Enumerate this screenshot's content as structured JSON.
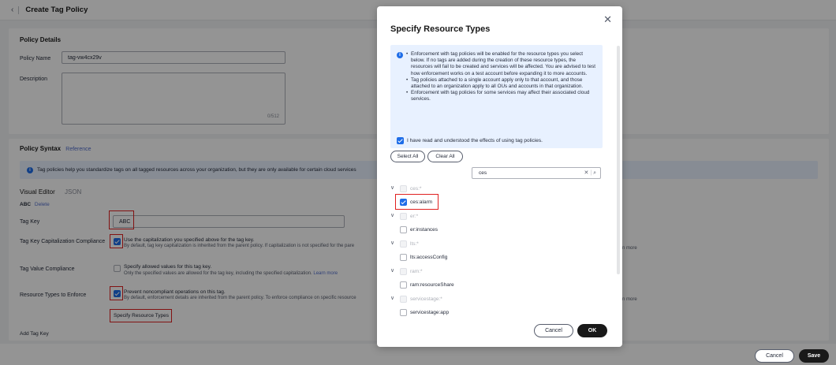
{
  "header": {
    "back_icon": "chevron-left-icon",
    "title": "Create Tag Policy"
  },
  "policy_details": {
    "section_title": "Policy Details",
    "name_label": "Policy Name",
    "name_value": "tag-vw4cx29v",
    "description_label": "Description",
    "description_counter": "0/512"
  },
  "policy_syntax": {
    "section_title": "Policy Syntax",
    "reference_link": "Reference",
    "info_text": "Tag policies help you standardize tags on all tagged resources across your organization, but they are only available for certain cloud services",
    "tab_visual": "Visual Editor",
    "tab_json": "JSON",
    "tag_name": "ABC",
    "delete_link": "Delete",
    "tag_key_label": "Tag Key",
    "tag_key_value": "ABC",
    "cap_label": "Tag Key Capitalization Compliance",
    "cap_text": "Use the capitalization you specified above for the tag key.",
    "cap_sub": "By default, tag key capitalization is inherited from the parent policy. If capitalization is not specified for the pare",
    "value_label": "Tag Value Compliance",
    "value_text": "Specify allowed values for this tag key.",
    "value_sub": "Only the specified values are allowed for the tag key, including the specified capitalization.",
    "value_learn": "Learn more",
    "enforce_label": "Resource Types to Enforce",
    "enforce_text": "Prevent noncompliant operations on this tag.",
    "enforce_sub": "By default, enforcement details are inherited from the parent policy. To enforce compliance on specific resource",
    "specify_link": "Specify Resource Types",
    "add_tag_key": "Add Tag Key",
    "more_1": "n more",
    "more_2": "n more"
  },
  "footer": {
    "cancel": "Cancel",
    "save": "Save"
  },
  "modal": {
    "title": "Specify Resource Types",
    "notice_items": [
      "Enforcement with tag policies will be enabled for the resource types you select below. If no tags are added during the creation of these resource types, the resources will fail to be created and services will be affected. You are advised to test how enforcement works on a test account before expanding it to more accounts.",
      "Tag policies attached to a single account apply only to that account, and those attached to an organization apply to all OUs and accounts in that organization.",
      "Enforcement with tag policies for some services may affect their associated cloud services."
    ],
    "ack_text": "I have read and understood the effects of using tag policies.",
    "select_all": "Select All",
    "clear_all": "Clear All",
    "search_value": "ces",
    "tree": [
      {
        "group": "ces:*",
        "child": "ces:alarm",
        "child_checked": true
      },
      {
        "group": "er:*",
        "child": "er:instances",
        "child_checked": false
      },
      {
        "group": "lts:*",
        "child": "lts:accessConfig",
        "child_checked": false
      },
      {
        "group": "ram:*",
        "child": "ram:resourceShare",
        "child_checked": false
      },
      {
        "group": "servicestage:*",
        "child": "servicestage:app",
        "child_checked": false
      }
    ],
    "cancel": "Cancel",
    "ok": "OK"
  }
}
